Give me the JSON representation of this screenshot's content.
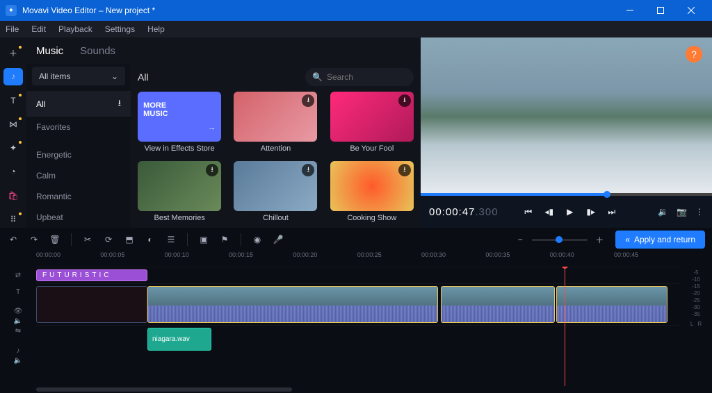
{
  "titlebar": {
    "title": "Movavi Video Editor – New project *"
  },
  "menu": {
    "file": "File",
    "edit": "Edit",
    "playback": "Playback",
    "settings": "Settings",
    "help": "Help"
  },
  "tabs": {
    "music": "Music",
    "sounds": "Sounds"
  },
  "sidelist": {
    "dropdown": "All items",
    "all": "All",
    "favorites": "Favorites",
    "energetic": "Energetic",
    "calm": "Calm",
    "romantic": "Romantic",
    "upbeat": "Upbeat"
  },
  "gallery": {
    "header": "All",
    "search_placeholder": "Search",
    "more_line1": "MORE",
    "more_line2": "MUSIC",
    "cards": {
      "c0": "View in Effects Store",
      "c1": "Attention",
      "c2": "Be Your Fool",
      "c3": "Best Memories",
      "c4": "Chillout",
      "c5": "Cooking Show"
    }
  },
  "preview": {
    "timecode_main": "00:00:47",
    "timecode_ms": ".300"
  },
  "toolbar": {
    "apply": "Apply and return"
  },
  "ruler": {
    "t0": "00:00:00",
    "t1": "00:00:05",
    "t2": "00:00:10",
    "t3": "00:00:15",
    "t4": "00:00:20",
    "t5": "00:00:25",
    "t6": "00:00:30",
    "t7": "00:00:35",
    "t8": "00:00:40",
    "t9": "00:00:45"
  },
  "clips": {
    "title_text": "FUTURISTIC",
    "audio_label": "niagara.wav"
  },
  "meters": {
    "m5": "-5",
    "m10": "-10",
    "m15": "-15",
    "m20": "-20",
    "m25": "-25",
    "m30": "-30",
    "m35": "-35",
    "lr_l": "L",
    "lr_r": "R"
  }
}
